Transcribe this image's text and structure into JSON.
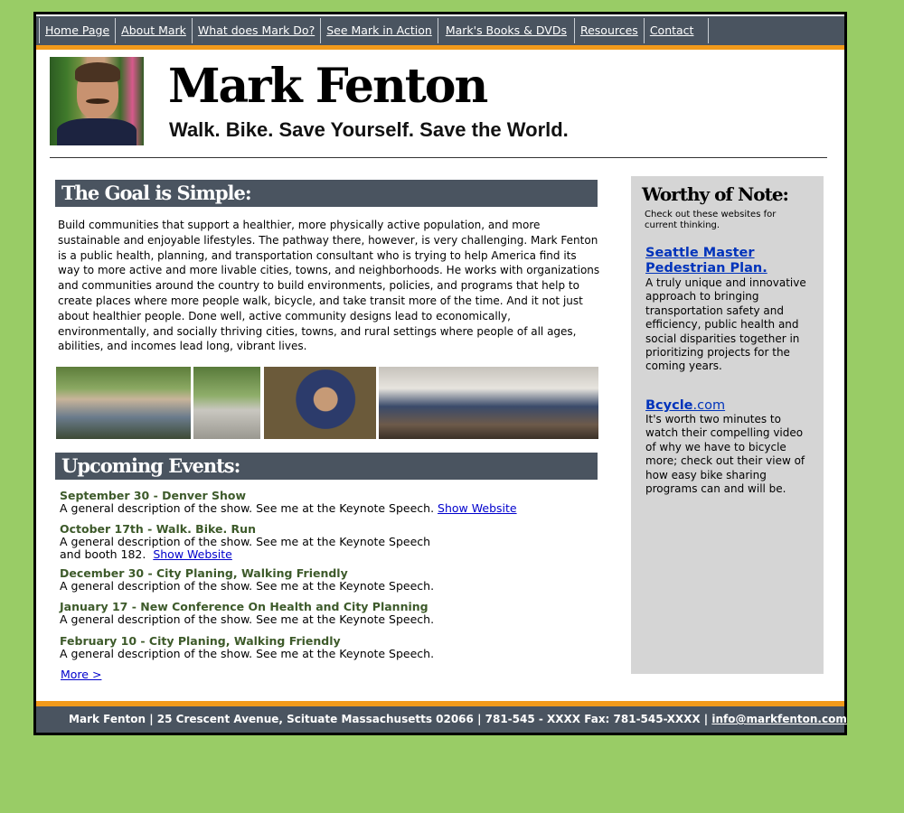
{
  "nav": {
    "items": [
      {
        "label": "Home Page"
      },
      {
        "label": "About Mark"
      },
      {
        "label": "What does Mark Do?"
      },
      {
        "label": "See Mark in Action"
      },
      {
        "label": "Mark's Books & DVDs"
      },
      {
        "label": "Resources"
      },
      {
        "label": "Contact"
      }
    ]
  },
  "header": {
    "name": "Mark Fenton",
    "tagline": "Walk. Bike. Save Yourself. Save the World."
  },
  "goal": {
    "heading": "The Goal is Simple:",
    "body": "Build communities that support a healthier, more physically active population, and more sustainable and enjoyable lifestyles. The pathway there, however, is very challenging. Mark Fenton is a public health, planning, and transportation consultant who is trying to help America find its way to more active and more livable cities, towns, and neighborhoods. He works with organizations and communities around the country to build environments, policies, and programs that help to create places where more people walk, bicycle, and take transit more of the time. And it not just about healthier people. Done well, active community designs lead to economically, environmentally, and socially thriving cities, towns, and rural settings where people of all ages, abilities, and incomes lead long, vibrant lives."
  },
  "events": {
    "heading": "Upcoming Events:",
    "items": [
      {
        "title": "September 30 - Denver Show",
        "desc": "A general description of the show. See me at the Keynote Speech.",
        "link": "Show Website"
      },
      {
        "title": "October 17th - Walk. Bike. Run",
        "desc": "A general description of the show. See me at the Keynote Speech and booth 182.",
        "link": "Show Website"
      },
      {
        "title": "December 30 - City Planing, Walking Friendly",
        "desc": "A general description of the show. See me at the Keynote Speech.",
        "link": ""
      },
      {
        "title": "January 17 - New Conference On Health and City Planning",
        "desc": "A general description of the show. See me at the Keynote Speech.",
        "link": ""
      },
      {
        "title": "February 10 - City Planing, Walking Friendly",
        "desc": "A general description of the show. See me at the Keynote Speech.",
        "link": ""
      }
    ],
    "more": "More >"
  },
  "sidebar": {
    "title": "Worthy of Note:",
    "subtitle": "Check out these websites for current thinking.",
    "link1": {
      "label": "Seattle Master Pedestrian Plan.",
      "desc": "A truly unique and innovative approach to bringing transportation safety and efficiency, public health and social disparities together in prioritizing projects for the coming years."
    },
    "link2": {
      "label_bold": "Bcycle",
      "label_rest": ".com",
      "desc": "It's worth two minutes to watch their compelling video of why we have to bicycle more; check out their view of how easy bike sharing programs can and will be."
    }
  },
  "footer": {
    "text": "Mark Fenton | 25 Crescent Avenue, Scituate Massachusetts 02066 | 781-545 - XXXX  Fax: 781-545-XXXX  |",
    "email": "info@markfenton.com"
  },
  "colors": {
    "page_bg": "#99cc66",
    "bar": "#4a5460",
    "accent": "#f29a1a",
    "event_title": "#3d5a2a",
    "link": "#0000cc"
  }
}
